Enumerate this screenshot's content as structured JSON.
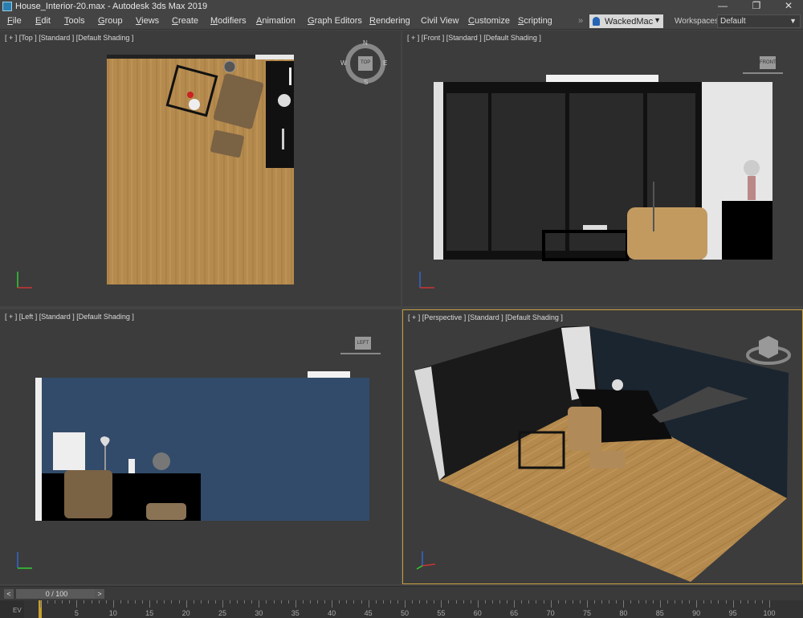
{
  "window": {
    "title": "House_Interior-20.max - Autodesk 3ds Max 2019",
    "minimize": "—",
    "restore": "❐",
    "close": "✕"
  },
  "menu": [
    {
      "label": "File",
      "u": "F",
      "rest": "ile"
    },
    {
      "label": "Edit",
      "u": "E",
      "rest": "dit"
    },
    {
      "label": "Tools",
      "u": "T",
      "rest": "ools"
    },
    {
      "label": "Group",
      "u": "G",
      "rest": "roup"
    },
    {
      "label": "Views",
      "u": "V",
      "rest": "iews"
    },
    {
      "label": "Create",
      "u": "C",
      "rest": "reate"
    },
    {
      "label": "Modifiers",
      "u": "M",
      "rest": "odifiers"
    },
    {
      "label": "Animation",
      "u": "A",
      "rest": "nimation"
    },
    {
      "label": "Graph Editors",
      "u": "G",
      "rest": "raph Editors"
    },
    {
      "label": "Rendering",
      "u": "R",
      "rest": "endering"
    },
    {
      "label": "Civil View",
      "u": "",
      "rest": "Civil View"
    },
    {
      "label": "Customize",
      "u": "C",
      "rest": "ustomize"
    },
    {
      "label": "Scripting",
      "u": "S",
      "rest": "cripting"
    }
  ],
  "user": {
    "name": "WackedMac",
    "caret": "▼"
  },
  "workspaces": {
    "label": "Workspaces:",
    "value": "Default",
    "caret": "▼"
  },
  "viewports": {
    "top": {
      "label": "[ + ] [Top ] [Standard ] [Default Shading ]",
      "cube": "TOP",
      "compass": [
        "N",
        "E",
        "S",
        "W"
      ]
    },
    "front": {
      "label": "[ + ] [Front ] [Standard ] [Default Shading ]",
      "cube": "FRONT"
    },
    "left": {
      "label": "[ + ] [Left ] [Standard ] [Default Shading ]",
      "cube": "LEFT"
    },
    "perspective": {
      "label": "[ + ] [Perspective ] [Standard ] [Default Shading ]"
    }
  },
  "axes": {
    "x": "x",
    "y": "y",
    "z": "z"
  },
  "timeline": {
    "frame": "0 / 100",
    "prev": "<",
    "next": ">",
    "corner": "EV"
  },
  "ticks": [
    "5",
    "10",
    "15",
    "20",
    "25",
    "30",
    "35",
    "40",
    "45",
    "50",
    "55",
    "60",
    "65",
    "70",
    "75",
    "80",
    "85",
    "90",
    "95",
    "100"
  ],
  "colors": {
    "wood": "#b58a4e",
    "wall_blue": "#324b6a",
    "accent_active": "#c8a040"
  }
}
